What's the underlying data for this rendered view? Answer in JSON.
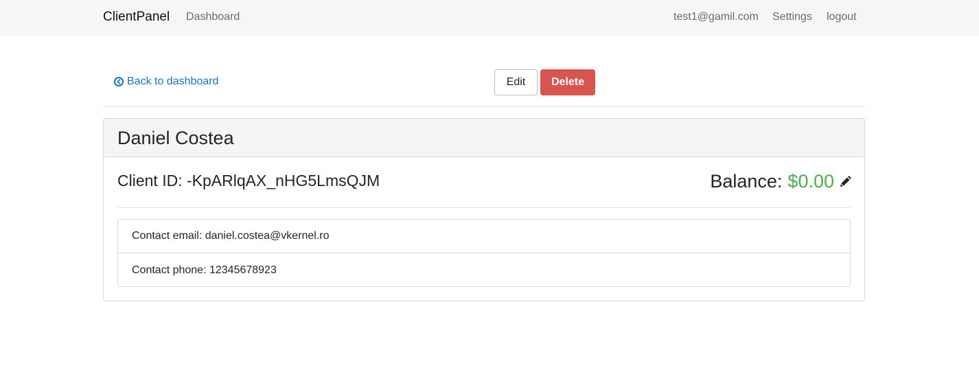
{
  "navbar": {
    "brand": "ClientPanel",
    "dashboard": "Dashboard",
    "user_email": "test1@gamil.com",
    "settings": "Settings",
    "logout": "logout"
  },
  "actions": {
    "back_label": "Back to dashboard",
    "edit_label": "Edit",
    "delete_label": "Delete"
  },
  "client": {
    "name": "Daniel Costea",
    "id_line": "Client ID: -KpARlqAX_nHG5LmsQJM",
    "balance_label": "Balance:",
    "balance_value": "$0.00",
    "contact_email": "Contact email: daniel.costea@vkernel.ro",
    "contact_phone": "Contact phone: 12345678923"
  },
  "icons": {
    "back": "circle-arrow-left-icon",
    "edit_balance": "pencil-icon"
  },
  "colors": {
    "link": "#1a73c9",
    "danger": "#d9534f",
    "balance": "#4cae4c",
    "navbar_bg": "#f6f6f6"
  }
}
